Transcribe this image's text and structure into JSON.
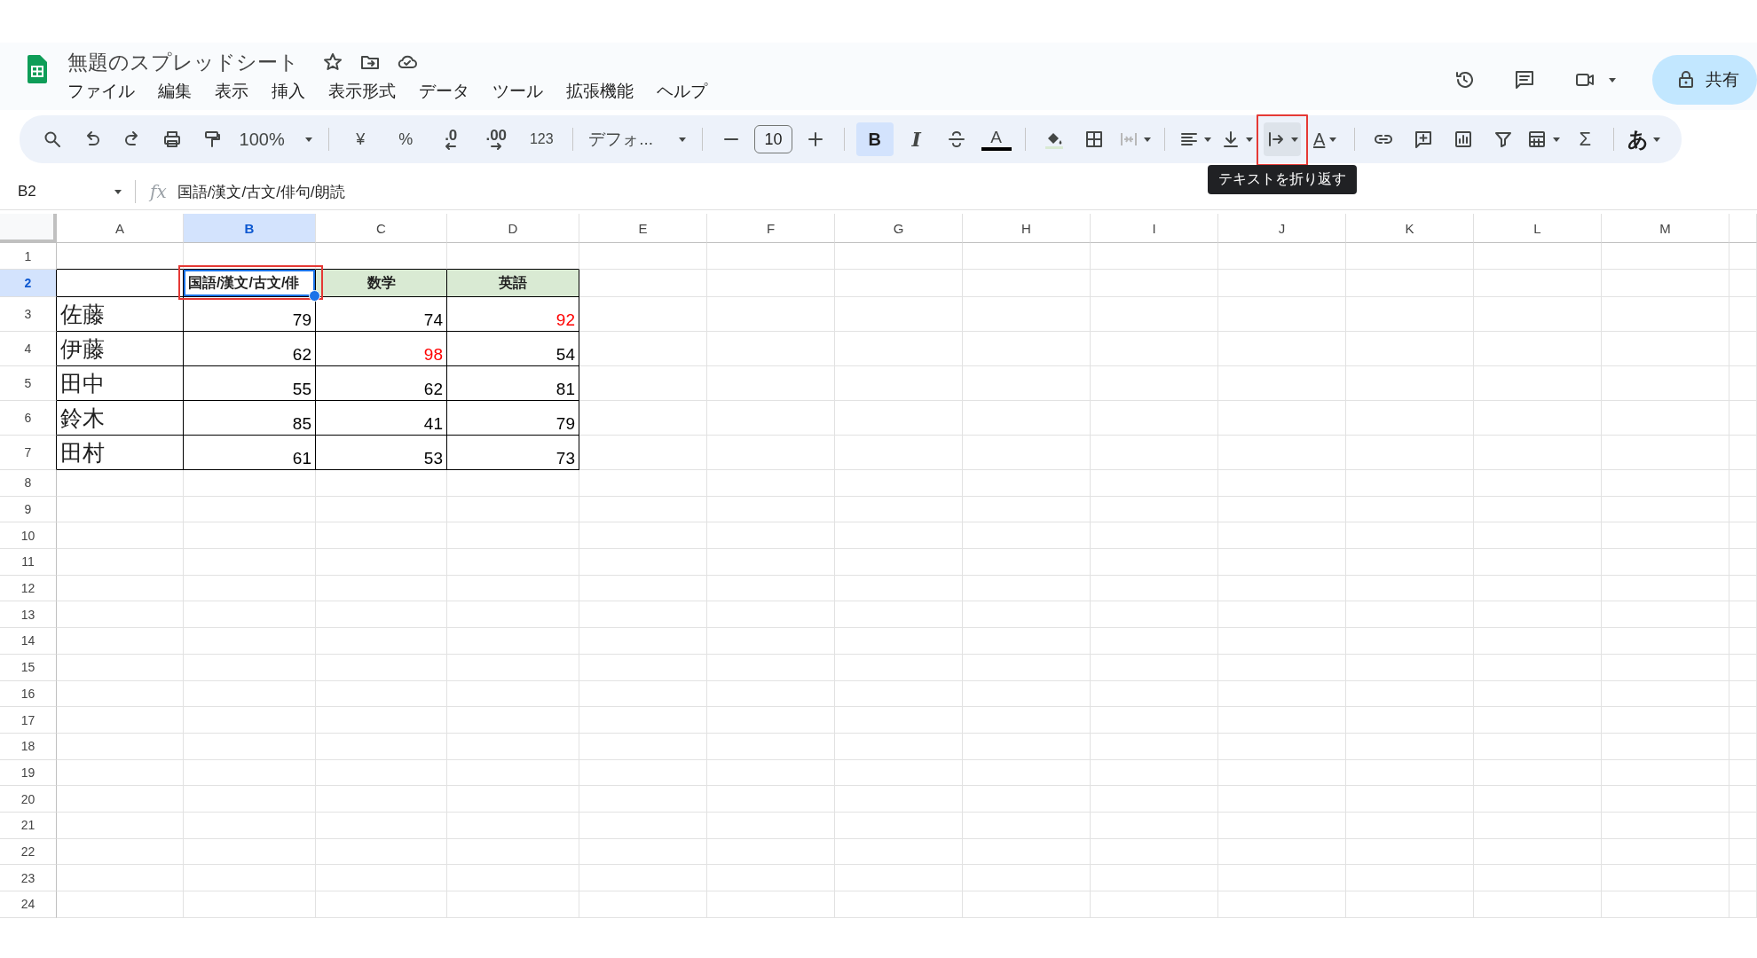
{
  "app": {
    "title": "無題のスプレッドシート",
    "share": "共有"
  },
  "menu": [
    "ファイル",
    "編集",
    "表示",
    "挿入",
    "表示形式",
    "データ",
    "ツール",
    "拡張機能",
    "ヘルプ"
  ],
  "toolbar": {
    "zoom": "100%",
    "currency": "¥",
    "percent": "%",
    "decrease_decimal": ".0",
    "increase_decimal": ".00",
    "number_format": "123",
    "font": "デフォ...",
    "font_size": "10",
    "bold": "B",
    "bold_on": true,
    "italic": "I",
    "text_color_letter": "A",
    "rotate_letter": "A",
    "sum": "Σ",
    "input_tools": "あ",
    "tooltip": "テキストを折り返す"
  },
  "formula_bar": {
    "name_box": "B2",
    "fx": "fx",
    "value": "国語/漢文/古文/俳句/朗読"
  },
  "columns": [
    {
      "label": "A",
      "selected": false
    },
    {
      "label": "B",
      "selected": true
    },
    {
      "label": "C",
      "selected": false
    },
    {
      "label": "D",
      "selected": false
    },
    {
      "label": "E",
      "selected": false
    },
    {
      "label": "F",
      "selected": false
    },
    {
      "label": "G",
      "selected": false
    },
    {
      "label": "H",
      "selected": false
    },
    {
      "label": "I",
      "selected": false
    },
    {
      "label": "J",
      "selected": false
    },
    {
      "label": "K",
      "selected": false
    },
    {
      "label": "L",
      "selected": false
    },
    {
      "label": "M",
      "selected": false
    }
  ],
  "row_numbers": [
    {
      "label": "1",
      "selected": false
    },
    {
      "label": "2",
      "selected": true
    },
    {
      "label": "3",
      "selected": false
    },
    {
      "label": "4",
      "selected": false
    },
    {
      "label": "5",
      "selected": false
    },
    {
      "label": "6",
      "selected": false
    },
    {
      "label": "7",
      "selected": false
    },
    {
      "label": "8",
      "selected": false
    },
    {
      "label": "9",
      "selected": false
    },
    {
      "label": "10",
      "selected": false
    },
    {
      "label": "11",
      "selected": false
    },
    {
      "label": "12",
      "selected": false
    },
    {
      "label": "13",
      "selected": false
    },
    {
      "label": "14",
      "selected": false
    },
    {
      "label": "15",
      "selected": false
    },
    {
      "label": "16",
      "selected": false
    },
    {
      "label": "17",
      "selected": false
    },
    {
      "label": "18",
      "selected": false
    },
    {
      "label": "19",
      "selected": false
    },
    {
      "label": "20",
      "selected": false
    },
    {
      "label": "21",
      "selected": false
    },
    {
      "label": "22",
      "selected": false
    },
    {
      "label": "23",
      "selected": false
    },
    {
      "label": "24",
      "selected": false
    }
  ],
  "table": {
    "header": [
      {
        "text": "国語/漢文/古文/俳",
        "selected": true
      },
      {
        "text": "数学",
        "selected": false
      },
      {
        "text": "英語",
        "selected": false
      }
    ],
    "records": [
      {
        "name": "佐藤",
        "scores": [
          {
            "value": "79",
            "color": "#000000"
          },
          {
            "value": "74",
            "color": "#000000"
          },
          {
            "value": "92",
            "color": "#ff0000"
          }
        ]
      },
      {
        "name": "伊藤",
        "scores": [
          {
            "value": "62",
            "color": "#000000"
          },
          {
            "value": "98",
            "color": "#ff0000"
          },
          {
            "value": "54",
            "color": "#000000"
          }
        ]
      },
      {
        "name": "田中",
        "scores": [
          {
            "value": "55",
            "color": "#000000"
          },
          {
            "value": "62",
            "color": "#000000"
          },
          {
            "value": "81",
            "color": "#000000"
          }
        ]
      },
      {
        "name": "鈴木",
        "scores": [
          {
            "value": "85",
            "color": "#000000"
          },
          {
            "value": "41",
            "color": "#000000"
          },
          {
            "value": "79",
            "color": "#000000"
          }
        ]
      },
      {
        "name": "田村",
        "scores": [
          {
            "value": "61",
            "color": "#000000"
          },
          {
            "value": "53",
            "color": "#000000"
          },
          {
            "value": "73",
            "color": "#000000"
          }
        ]
      }
    ]
  }
}
